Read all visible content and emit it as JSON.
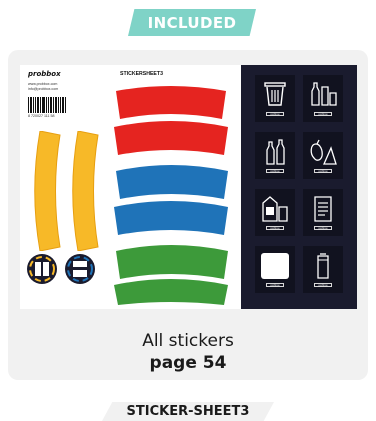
{
  "badge": {
    "label": "INCLUDED"
  },
  "card": {
    "caption_line1": "All stickers",
    "caption_line2": "page 54",
    "sheet": {
      "brand": "probbox",
      "contact_lines": [
        "www.probbox.com",
        "info@probbox.com"
      ],
      "title": "STICKERSHEET3",
      "barcode_number": "8 720027 111 58",
      "icon_tiles": [
        {
          "icon": "trash-bin-icon",
          "label": "probbox"
        },
        {
          "icon": "bottles-cans-icon",
          "label": "probbox"
        },
        {
          "icon": "bottles-icon",
          "label": "probbox"
        },
        {
          "icon": "organic-waste-icon",
          "label": "probbox"
        },
        {
          "icon": "food-cartons-icon",
          "label": "probbox"
        },
        {
          "icon": "paper-icon",
          "label": "probbox"
        },
        {
          "icon": "blank-label-icon",
          "label": "probbox"
        },
        {
          "icon": "can-icon",
          "label": "probbox"
        }
      ],
      "colors": {
        "yellow": "#f7b928",
        "red": "#e52420",
        "blue": "#1f73b8",
        "green": "#3d9a3a",
        "dark_panel": "#1a1b2e"
      }
    }
  },
  "footer": {
    "label": "STICKER-SHEET3"
  }
}
